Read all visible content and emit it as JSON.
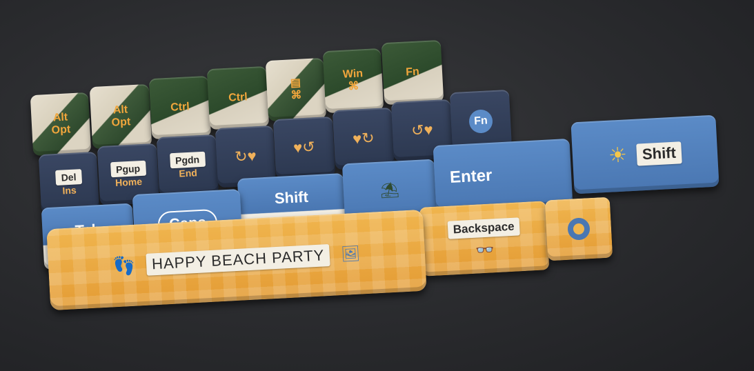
{
  "row1": [
    {
      "top": "Alt",
      "bottom": "Opt"
    },
    {
      "top": "Alt",
      "bottom": "Opt"
    },
    {
      "top": "Ctrl",
      "bottom": ""
    },
    {
      "top": "Ctrl",
      "bottom": ""
    },
    {
      "top": "▤",
      "bottom": "⌘"
    },
    {
      "top": "Win",
      "bottom": "⌘"
    },
    {
      "top": "Fn",
      "bottom": ""
    }
  ],
  "row2": [
    {
      "top": "Del",
      "bottom": "Ins"
    },
    {
      "top": "Pgup",
      "bottom": "Home"
    },
    {
      "top": "Pgdn",
      "bottom": "End"
    },
    {
      "icon": "↻♥"
    },
    {
      "icon": "♥↺"
    },
    {
      "icon": "♥↻"
    },
    {
      "icon": "↺♥"
    },
    {
      "label": "Fn"
    }
  ],
  "row3": {
    "shift_left": "Shift",
    "enter": "Enter",
    "shift_right": "Shift"
  },
  "row4": {
    "tab": "Tab",
    "caps": "Caps",
    "shift": "Shift",
    "backspace": "Backspace"
  },
  "spacebar": "HAPPY BEACH PARTY"
}
